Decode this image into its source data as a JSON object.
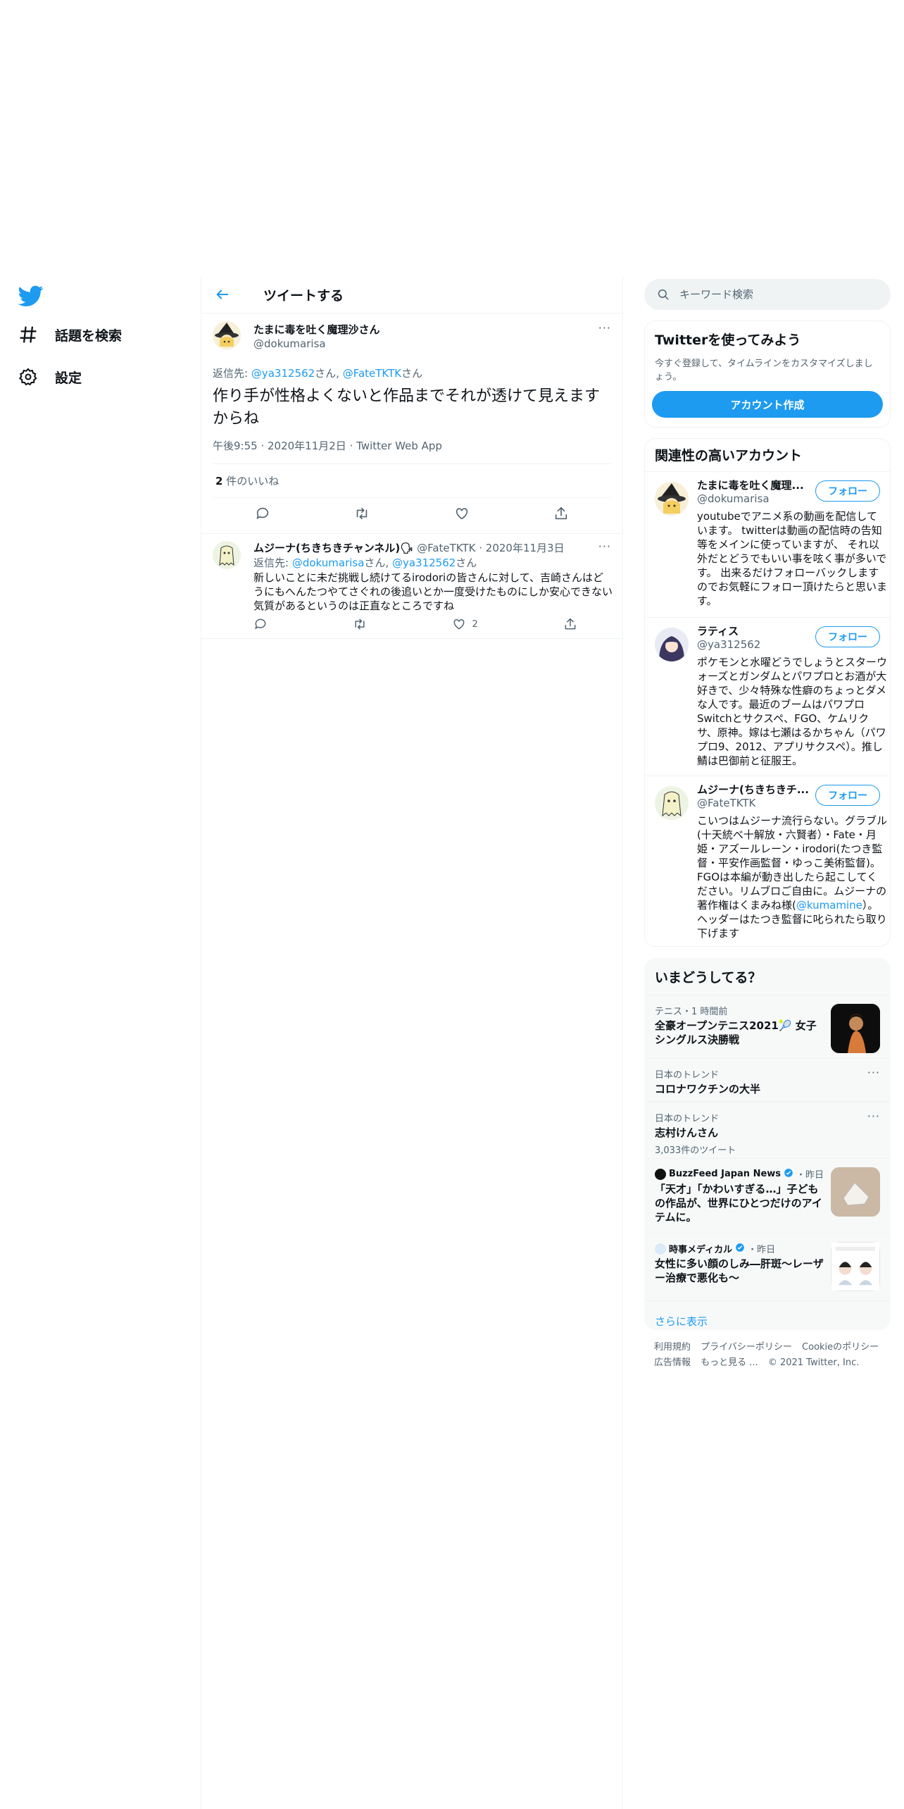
{
  "nav": {
    "explore_label": "話題を検索",
    "settings_label": "設定"
  },
  "header": {
    "title": "ツイートする"
  },
  "main_tweet": {
    "name": "たまに毒を吐く魔理沙さん",
    "handle": "@dokumarisa",
    "reply_prefix": "返信先: ",
    "reply_user1": "@ya312562",
    "reply_mid": "さん, ",
    "reply_user2": "@FateTKTK",
    "reply_suffix": "さん",
    "text": "作り手が性格よくないと作品までそれが透けて見えますからね",
    "time": "午後9:55",
    "date": "2020年11月2日",
    "source": "Twitter Web App",
    "likes_count": "2",
    "likes_label": "件のいいね"
  },
  "reply_tweet": {
    "name": "ムジーナ(ちきちきチャンネル)🗣",
    "handle": "@FateTKTK",
    "date": "2020年11月3日",
    "reply_prefix": "返信先: ",
    "reply_user1": "@dokumarisa",
    "reply_mid": "さん, ",
    "reply_user2": "@ya312562",
    "reply_suffix": "さん",
    "text": "新しいことに未だ挑戦し続けてるirodoriの皆さんに対して、吉崎さんはどうにもへんたつやてさぐれの後追いとか一度受けたものにしか安心できない気質があるというのは正直なところですね",
    "like_count": "2"
  },
  "search": {
    "placeholder": "キーワード検索"
  },
  "signup": {
    "title": "Twitterを使ってみよう",
    "subtitle": "今すぐ登録して、タイムラインをカスタマイズしましょう。",
    "button": "アカウント作成"
  },
  "related": {
    "title": "関連性の高いアカウント",
    "follow_label": "フォロー",
    "accounts": [
      {
        "name": "たまに毒を吐く魔理...",
        "handle": "@dokumarisa",
        "bio": "youtubeでアニメ系の動画を配信しています。 twitterは動画の配信時の告知等をメインに使っていますが、 それ以外だとどうでもいい事を呟く事が多いです。 出来るだけフォローバックしますのでお気軽にフォロー頂けたらと思います。"
      },
      {
        "name": "ラティス",
        "handle": "@ya312562",
        "bio": "ポケモンと水曜どうでしょうとスターウォーズとガンダムとパワプロとお酒が大好きで、少々特殊な性癖のちょっとダメな人です。最近のブームはパワプロSwitchとサクスペ、FGO、ケムリクサ、原神。嫁は七瀬はるかちゃん（パワプロ9、2012、アプリサクスペ）。推し鯖は巴御前と征服王。"
      },
      {
        "name": "ムジーナ(ちきちきチ...",
        "handle": "@FateTKTK",
        "bio_before": "こいつはムジーナ流行らない。グラブル(十天統べ十解放・六賢者）・Fate・月姫・アズールレーン・irodori(たつき監督・平安作画監督・ゆっこ美術監督)。FGOは本編が動き出したら起こしてください。リムブロご自由に。ムジーナの著作権はくまみね様(",
        "bio_link": "@kumamine",
        "bio_after": "）。ヘッダーはたつき監督に叱られたら取り下げます"
      }
    ]
  },
  "trends": {
    "title": "いまどうしてる？",
    "items": [
      {
        "meta": "テニス・1 時間前",
        "topic": "全豪オープンテニス2021🎾 女子シングルス決勝戦"
      },
      {
        "meta": "日本のトレンド",
        "topic": "コロナワクチンの大半"
      },
      {
        "meta": "日本のトレンド",
        "topic": "志村けんさん",
        "count": "3,033件のツイート"
      },
      {
        "source": "BuzzFeed Japan News",
        "time": "・昨日",
        "topic": "「天才」「かわいすぎる…」子どもの作品が、世界にひとつだけのアイテムに。"
      },
      {
        "source": "時事メディカル",
        "time": "・昨日",
        "topic": "女性に多い顔のしみ―肝斑～レーザー治療で悪化も～"
      }
    ],
    "show_more": "さらに表示"
  },
  "footer": {
    "links": [
      "利用規約",
      "プライバシーポリシー",
      "Cookieのポリシー",
      "広告情報",
      "もっと見る ..."
    ],
    "copyright": "© 2021 Twitter, Inc."
  },
  "colors": {
    "accent": "#1d9bf0",
    "text": "#0f1419",
    "muted": "#536471",
    "border": "#eff3f4"
  }
}
